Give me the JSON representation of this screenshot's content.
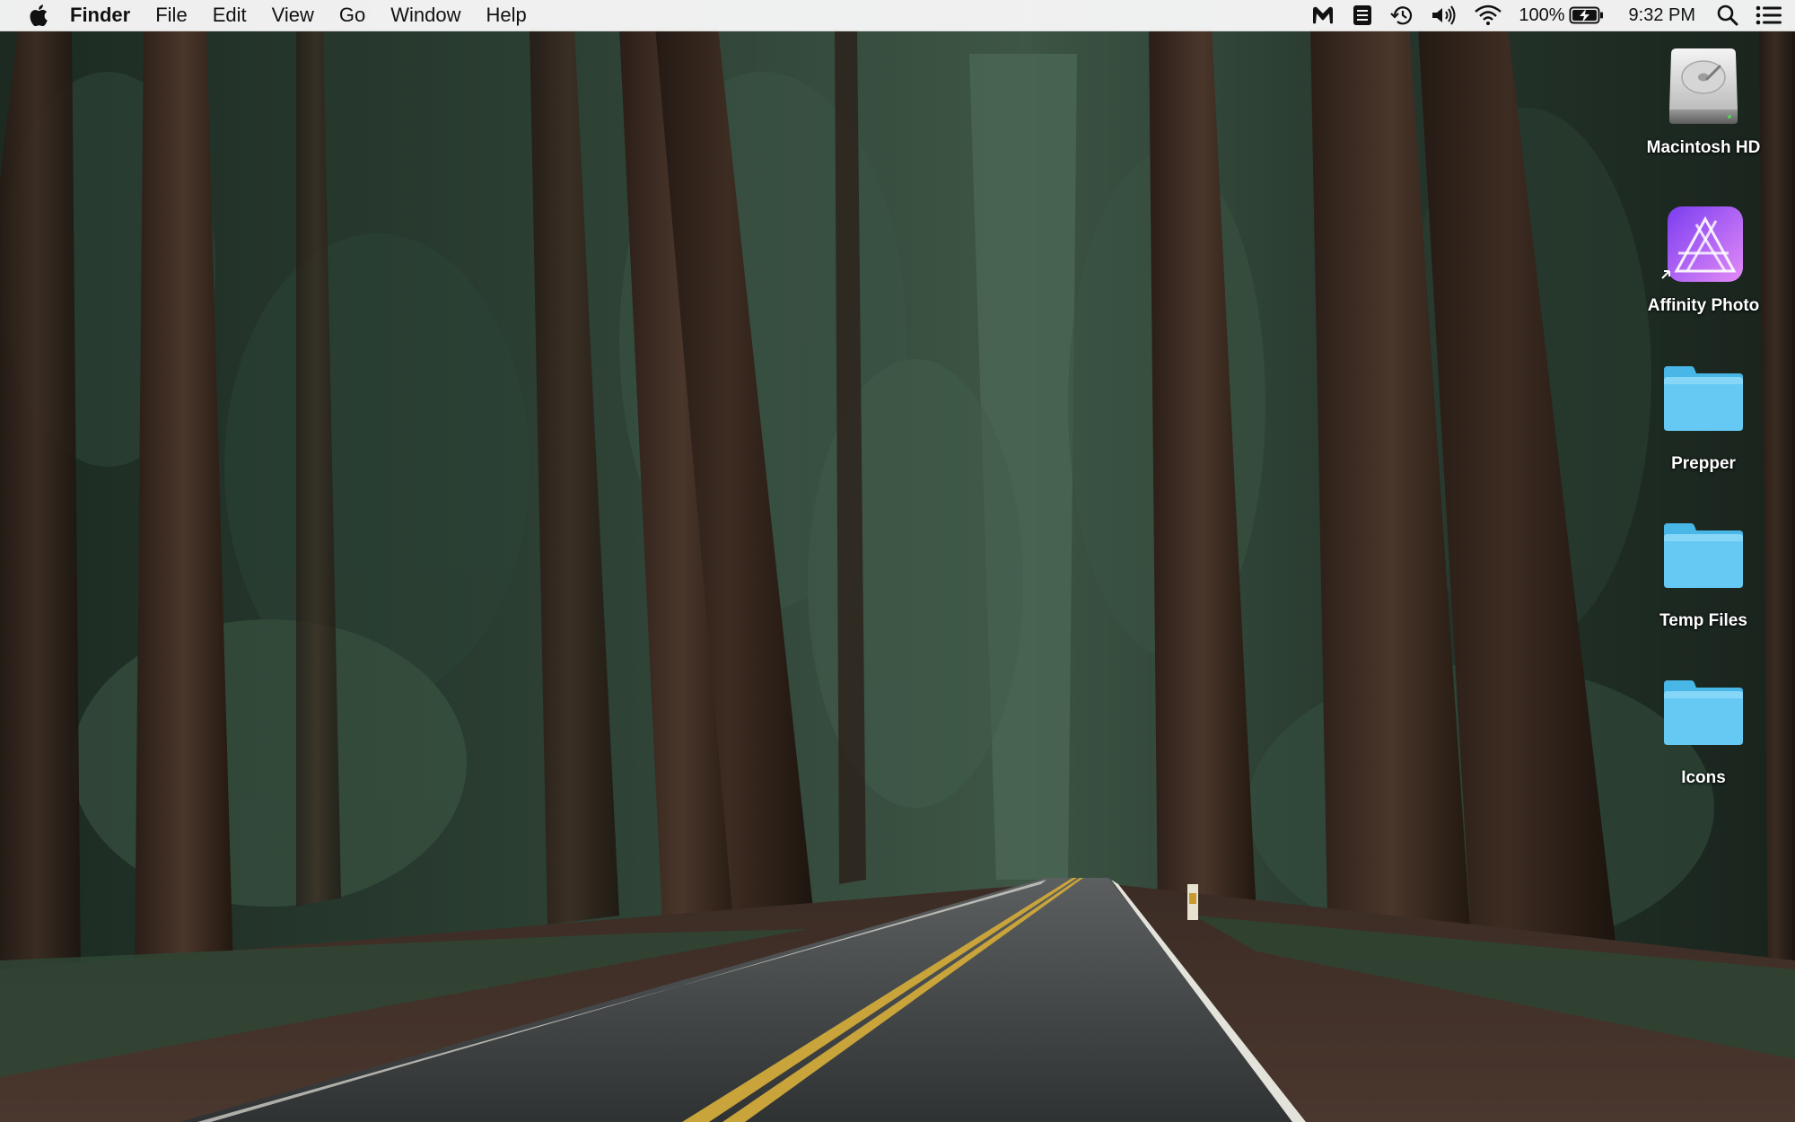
{
  "menubar": {
    "apple_icon": "apple-logo-icon",
    "app_name": "Finder",
    "menus": [
      "File",
      "Edit",
      "View",
      "Go",
      "Window",
      "Help"
    ],
    "status": {
      "icons": [
        "malwarebytes-icon",
        "notes-icon",
        "time-machine-icon",
        "volume-icon",
        "wifi-icon"
      ],
      "battery_percent": "100%",
      "battery_icon": "battery-charging-icon",
      "clock": "9:32 PM",
      "spotlight_icon": "search-icon",
      "notification_icon": "notification-center-icon"
    }
  },
  "desktop": {
    "icons": [
      {
        "label": "Macintosh HD",
        "icon": "hard-drive-icon"
      },
      {
        "label": "Affinity Photo",
        "icon": "affinity-photo-icon"
      },
      {
        "label": "Prepper",
        "icon": "folder-icon"
      },
      {
        "label": "Temp Files",
        "icon": "folder-icon"
      },
      {
        "label": "Icons",
        "icon": "folder-icon"
      }
    ]
  },
  "colors": {
    "menubar_bg": "#f6f6f6",
    "folder_blue": "#5cc6f2",
    "affinity_purple": "#c45bf2"
  }
}
